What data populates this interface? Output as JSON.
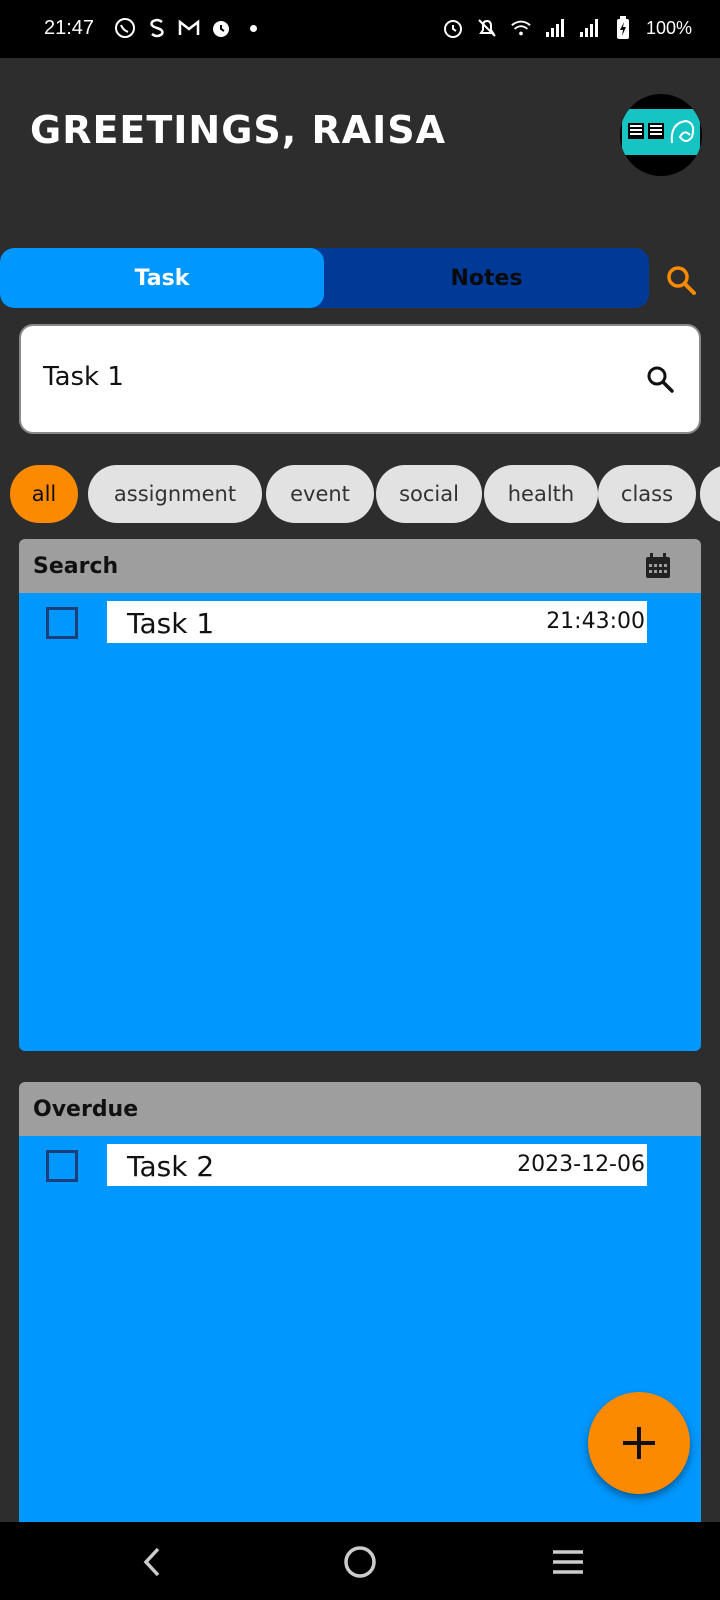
{
  "status_bar": {
    "time": "21:47",
    "left_icons": [
      "whatsapp-icon",
      "s-app-icon",
      "gmail-icon",
      "alarm-icon"
    ],
    "right_icons": [
      "alarm-icon",
      "notifications-off-icon",
      "wifi-icon",
      "signal-icon",
      "signal-icon",
      "battery-charging-icon"
    ],
    "battery": "100%"
  },
  "header": {
    "greeting": "GREETINGS, RAISA"
  },
  "tabs": [
    {
      "label": "Task",
      "active": true
    },
    {
      "label": "Notes",
      "active": false
    }
  ],
  "search": {
    "value": "Task 1",
    "placeholder": ""
  },
  "filters": [
    {
      "label": "all",
      "active": true
    },
    {
      "label": "assignment",
      "active": false
    },
    {
      "label": "event",
      "active": false
    },
    {
      "label": "social",
      "active": false
    },
    {
      "label": "health",
      "active": false
    },
    {
      "label": "class",
      "active": false
    }
  ],
  "sections": [
    {
      "title": "Search",
      "icon": "calendar-icon",
      "tasks": [
        {
          "title": "Task 1",
          "meta": "21:43:00",
          "checked": false
        }
      ]
    },
    {
      "title": "Overdue",
      "tasks": [
        {
          "title": "Task 2",
          "meta": "2023-12-06",
          "checked": false
        }
      ]
    }
  ],
  "colors": {
    "background": "#2d2d2d",
    "accent_blue": "#0097fe",
    "dark_blue": "#013a96",
    "orange": "#fb8a00",
    "section_header": "#9e9e9e"
  }
}
